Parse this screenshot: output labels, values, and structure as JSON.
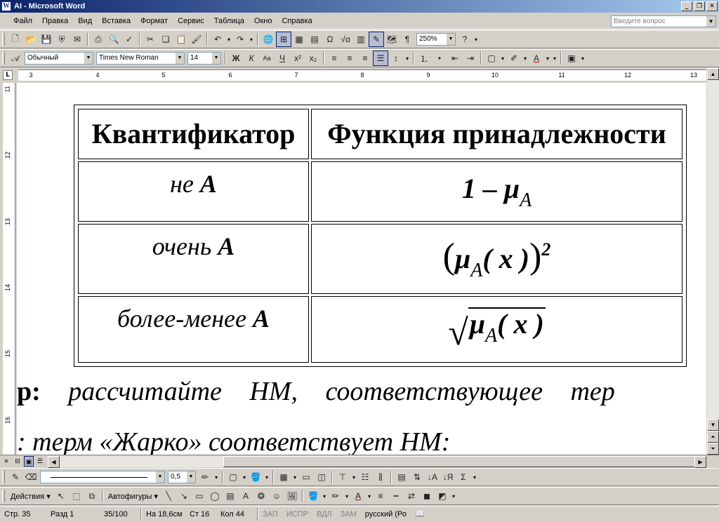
{
  "window": {
    "title": "AI - Microsoft Word",
    "app_icon": "W"
  },
  "menu": {
    "items": [
      "Файл",
      "Правка",
      "Вид",
      "Вставка",
      "Формат",
      "Сервис",
      "Таблица",
      "Окно",
      "Справка"
    ],
    "ask_placeholder": "Введите вопрос"
  },
  "toolbar_standard": {
    "zoom": "250%"
  },
  "toolbar_format": {
    "style": "Обычный",
    "font": "Times New Roman",
    "size": "14"
  },
  "ruler": {
    "numbers": [
      "3",
      "4",
      "5",
      "6",
      "7",
      "8",
      "9",
      "10",
      "11",
      "12",
      "13"
    ],
    "vnumbers": [
      "11",
      "12",
      "13",
      "14",
      "15",
      "16"
    ]
  },
  "table": {
    "headers": [
      "Квантификатор",
      "Функция принадлежности"
    ],
    "rows": [
      {
        "q_prefix": "не",
        "q_var": "A",
        "func": "1 – μ",
        "func_sub": "A"
      },
      {
        "q_prefix": "очень",
        "q_var": "A",
        "func_mu": "μ",
        "func_sub": "A",
        "func_arg": "( x )",
        "func_sup": "2"
      },
      {
        "q_prefix": "более-менее",
        "q_var": "A",
        "func_mu": "μ",
        "func_sub": "A",
        "func_arg": "( x )"
      }
    ]
  },
  "body": {
    "line1_bold": "р:",
    "line1_text": "рассчитайте НМ, соответствующее тер",
    "line2_text": ": терм «Жарко» соответствует НМ:"
  },
  "drawing": {
    "line_width": "0,5",
    "actions": "Действия",
    "autoshapes": "Автофигуры"
  },
  "status": {
    "page": "Стр. 35",
    "section": "Разд 1",
    "pages": "35/100",
    "at": "На 18,6см",
    "line": "Ст 16",
    "col": "Кол 44",
    "rec": "ЗАП",
    "trk": "ИСПР",
    "ext": "ВДЛ",
    "ovr": "ЗАМ",
    "lang": "русский (Ро"
  }
}
